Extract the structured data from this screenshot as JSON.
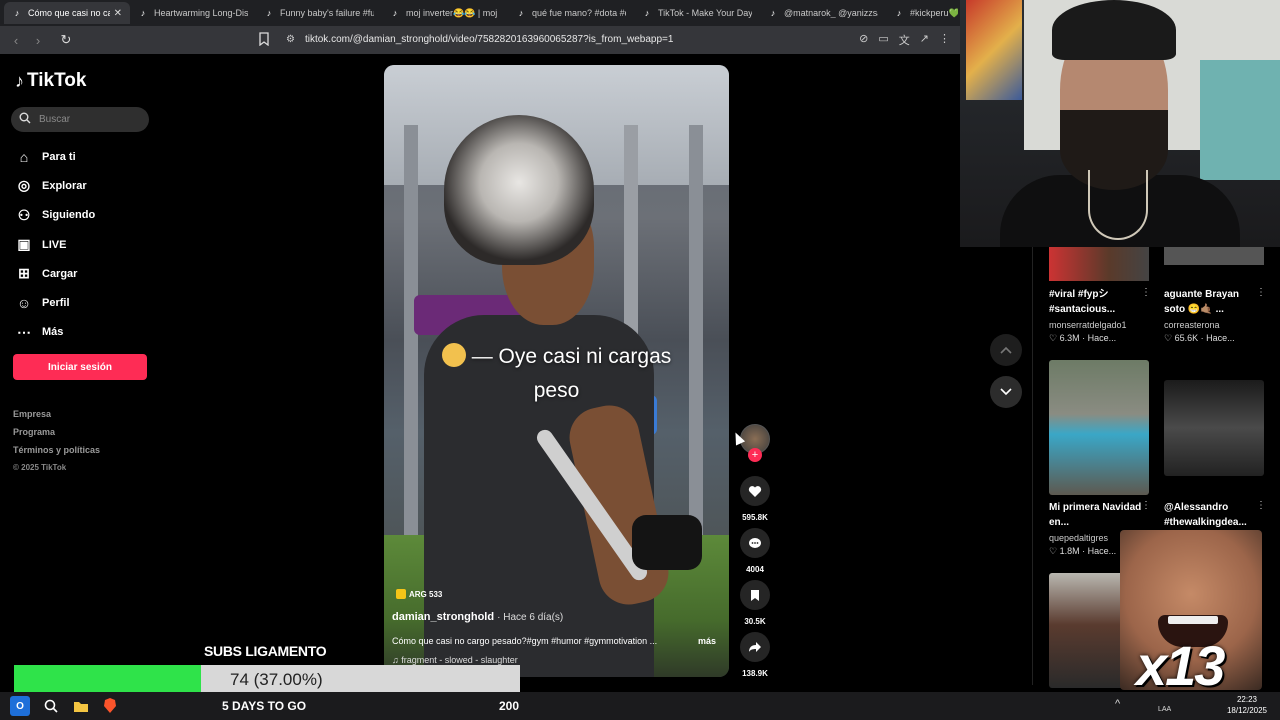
{
  "browser": {
    "tabs": [
      {
        "label": "Cómo que casi no car",
        "active": true
      },
      {
        "label": "Heartwarming Long-Dista",
        "active": false
      },
      {
        "label": "Funny baby's failure #funn",
        "active": false
      },
      {
        "label": "moj inverter😂😂 | moj in",
        "active": false
      },
      {
        "label": "qué fue mano? #dota #do",
        "active": false
      },
      {
        "label": "TikTok - Make Your Day",
        "active": false
      },
      {
        "label": "@matnarok_ @yanizzsala",
        "active": false
      },
      {
        "label": "#kickperu💚",
        "active": false
      }
    ],
    "url": "tiktok.com/@damian_stronghold/video/7582820163960065287?is_from_webapp=1"
  },
  "sidebar": {
    "logo": "TikTok",
    "search_placeholder": "Buscar",
    "items": [
      {
        "label": "Para ti",
        "icon": "home-icon"
      },
      {
        "label": "Explorar",
        "icon": "compass-icon"
      },
      {
        "label": "Siguiendo",
        "icon": "following-icon"
      },
      {
        "label": "LIVE",
        "icon": "live-icon"
      },
      {
        "label": "Cargar",
        "icon": "upload-icon"
      },
      {
        "label": "Perfil",
        "icon": "profile-icon"
      },
      {
        "label": "Más",
        "icon": "more-icon"
      }
    ],
    "login_label": "Iniciar sesión",
    "footer": [
      "Empresa",
      "Programa",
      "Términos y políticas"
    ],
    "copyright": "© 2025 TikTok"
  },
  "video": {
    "caption_line1": "— Oye casi ni cargas",
    "caption_line2": "peso",
    "badge": "ARG 533",
    "author": "damian_stronghold",
    "posted": "· Hace 6 día(s)",
    "description": "Cómo que casi no cargo pesado?#gym #humor #gymmotivation ...",
    "more_label": "más",
    "music": "♫  fragment - slowed - slaughter"
  },
  "actions": {
    "likes": "595.8K",
    "comments": "4004",
    "saves": "30.5K",
    "shares": "138.9K"
  },
  "related": [
    {
      "title": "#viral #fypシ #santacious...",
      "user": "monserratdelgado1",
      "stats": "♡ 6.3M  ·  Hace..."
    },
    {
      "title": "aguante Brayan soto 😁🤙🏽 ...",
      "user": "correasterona",
      "stats": "♡ 65.6K  ·  Hace..."
    },
    {
      "title": "Mi primera Navidad en...",
      "user": "quepedaltigres",
      "stats": "♡ 1.8M  ·  Hace..."
    },
    {
      "title": "@Alessandro #thewalkingdea...",
      "user": "",
      "stats": ""
    }
  ],
  "stream": {
    "goal_title": "SUBS LIGAMENTO",
    "goal_progress_text": "74 (37.00%)",
    "goal_fraction": 0.37,
    "days_label": "5 DAYS TO GO",
    "goal_target": "200",
    "meme_multiplier": "x13"
  },
  "taskbar": {
    "lang": "LAA",
    "time": "22:23",
    "date": "18/12/2025"
  },
  "colors": {
    "accent": "#fe2c55",
    "goal_fill": "#2fe34a"
  }
}
